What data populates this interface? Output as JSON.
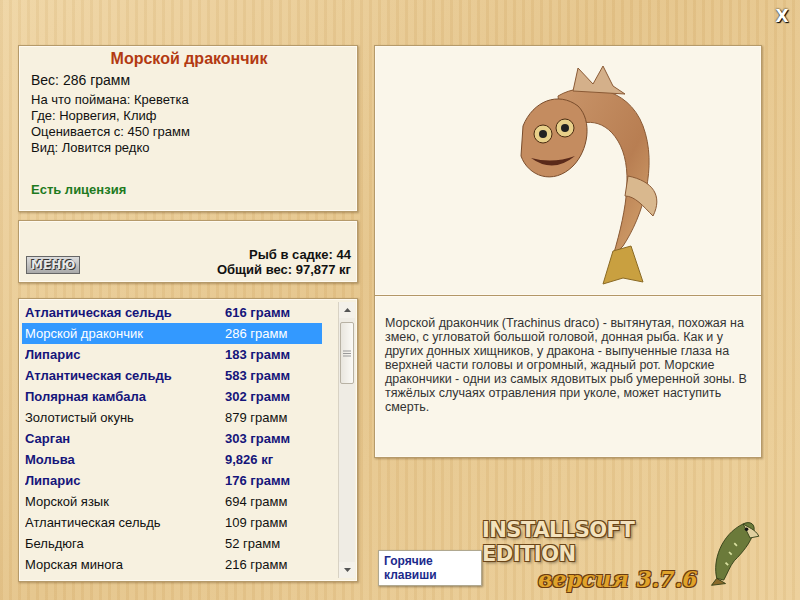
{
  "window": {
    "close": "X"
  },
  "fish": {
    "title": "Морской дракончик",
    "weight": "Вес: 286 грамм",
    "details": [
      "На что поймана: Креветка",
      "Где: Норвегия, Клиф",
      "Оценивается с: 450 грамм",
      "Вид: Ловится редко"
    ],
    "license": "Есть лицензия",
    "description": "Морской дракончик (Trachinus draco) - вытянутая, похожая на змею, с угловатой большой головой, донная рыба. Как и у других донных хищников, у дракона - выпученные глаза на верхней части головы и огромный, жадный рот. Морские дракончики - одни из самых ядовитых рыб умеренной зоны. В тяжёлых случаях отравления при уколе, может наступить смерть."
  },
  "cage": {
    "menu_button": "МЕНЮ",
    "count": "Рыб в садке: 44",
    "total": "Общий вес: 97,877 кг"
  },
  "catches": [
    {
      "name": "Атлантическая сельдь",
      "weight": "616 грамм",
      "kind": "bold",
      "selected": false
    },
    {
      "name": "Морской дракончик",
      "weight": "286 грамм",
      "kind": "plain",
      "selected": true
    },
    {
      "name": "Липарис",
      "weight": "183 грамм",
      "kind": "bold",
      "selected": false
    },
    {
      "name": "Атлантическая сельдь",
      "weight": "583 грамм",
      "kind": "bold",
      "selected": false
    },
    {
      "name": "Полярная камбала",
      "weight": "302 грамм",
      "kind": "bold",
      "selected": false
    },
    {
      "name": "Золотистый окунь",
      "weight": "879 грамм",
      "kind": "plain",
      "selected": false
    },
    {
      "name": "Сарган",
      "weight": "303 грамм",
      "kind": "bold",
      "selected": false
    },
    {
      "name": "Мольва",
      "weight": "9,826 кг",
      "kind": "bold",
      "selected": false
    },
    {
      "name": "Липарис",
      "weight": "176 грамм",
      "kind": "bold",
      "selected": false
    },
    {
      "name": "Морской язык",
      "weight": "694 грамм",
      "kind": "plain",
      "selected": false
    },
    {
      "name": "Атлантическая сельдь",
      "weight": "109 грамм",
      "kind": "plain",
      "selected": false
    },
    {
      "name": "Бельдюга",
      "weight": "52 грамм",
      "kind": "plain",
      "selected": false
    },
    {
      "name": "Морская минога",
      "weight": "216 грамм",
      "kind": "plain",
      "selected": false
    }
  ],
  "footer": {
    "hotkeys": "Горячие клавиши",
    "logo": "INSTALLSOFT EDITION",
    "version": "версия 3.7.6"
  }
}
